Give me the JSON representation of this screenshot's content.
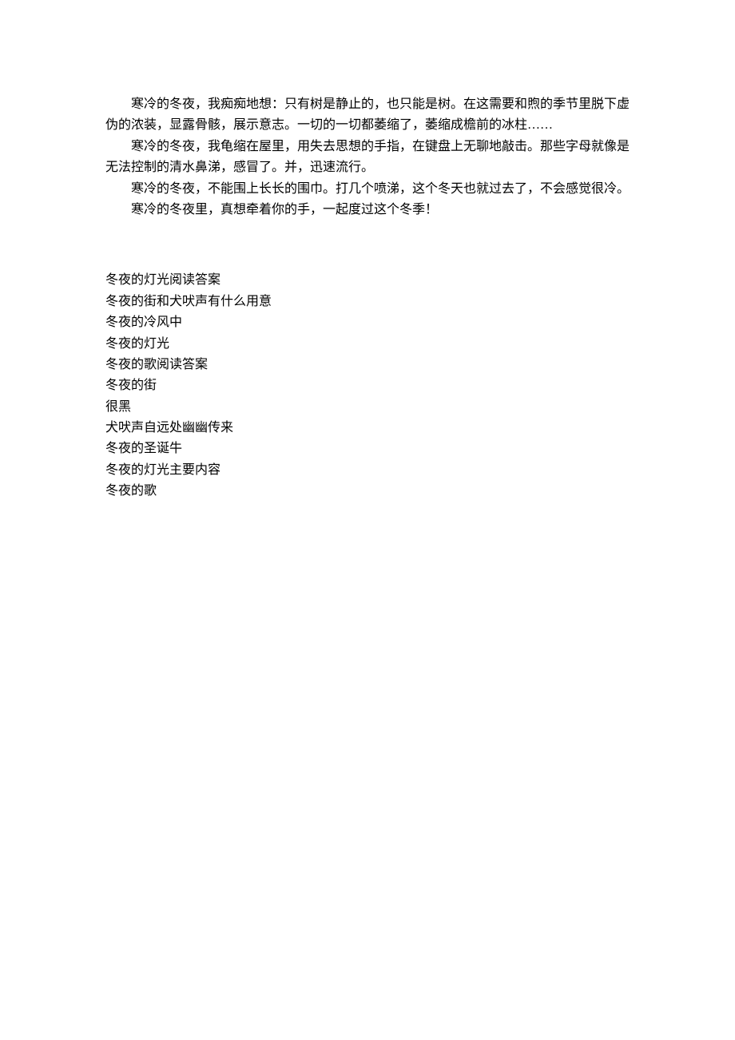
{
  "paragraphs": [
    "寒冷的冬夜，我痴痴地想：只有树是静止的，也只能是树。在这需要和煦的季节里脱下虚伪的浓装，显露骨骸，展示意志。一切的一切都萎缩了，萎缩成檐前的冰柱……",
    "寒冷的冬夜，我龟缩在屋里，用失去思想的手指，在键盘上无聊地敲击。那些字母就像是无法控制的清水鼻涕，感冒了。并，迅速流行。",
    "寒冷的冬夜，不能围上长长的围巾。打几个喷涕，这个冬天也就过去了，不会感觉很冷。",
    "寒冷的冬夜里，真想牵着你的手，一起度过这个冬季！"
  ],
  "list": [
    "冬夜的灯光阅读答案",
    "冬夜的街和犬吠声有什么用意",
    "冬夜的冷风中",
    "冬夜的灯光",
    "冬夜的歌阅读答案",
    "冬夜的街",
    "很黑",
    "犬吠声自远处幽幽传来",
    "冬夜的圣诞牛",
    "冬夜的灯光主要内容",
    "冬夜的歌"
  ]
}
